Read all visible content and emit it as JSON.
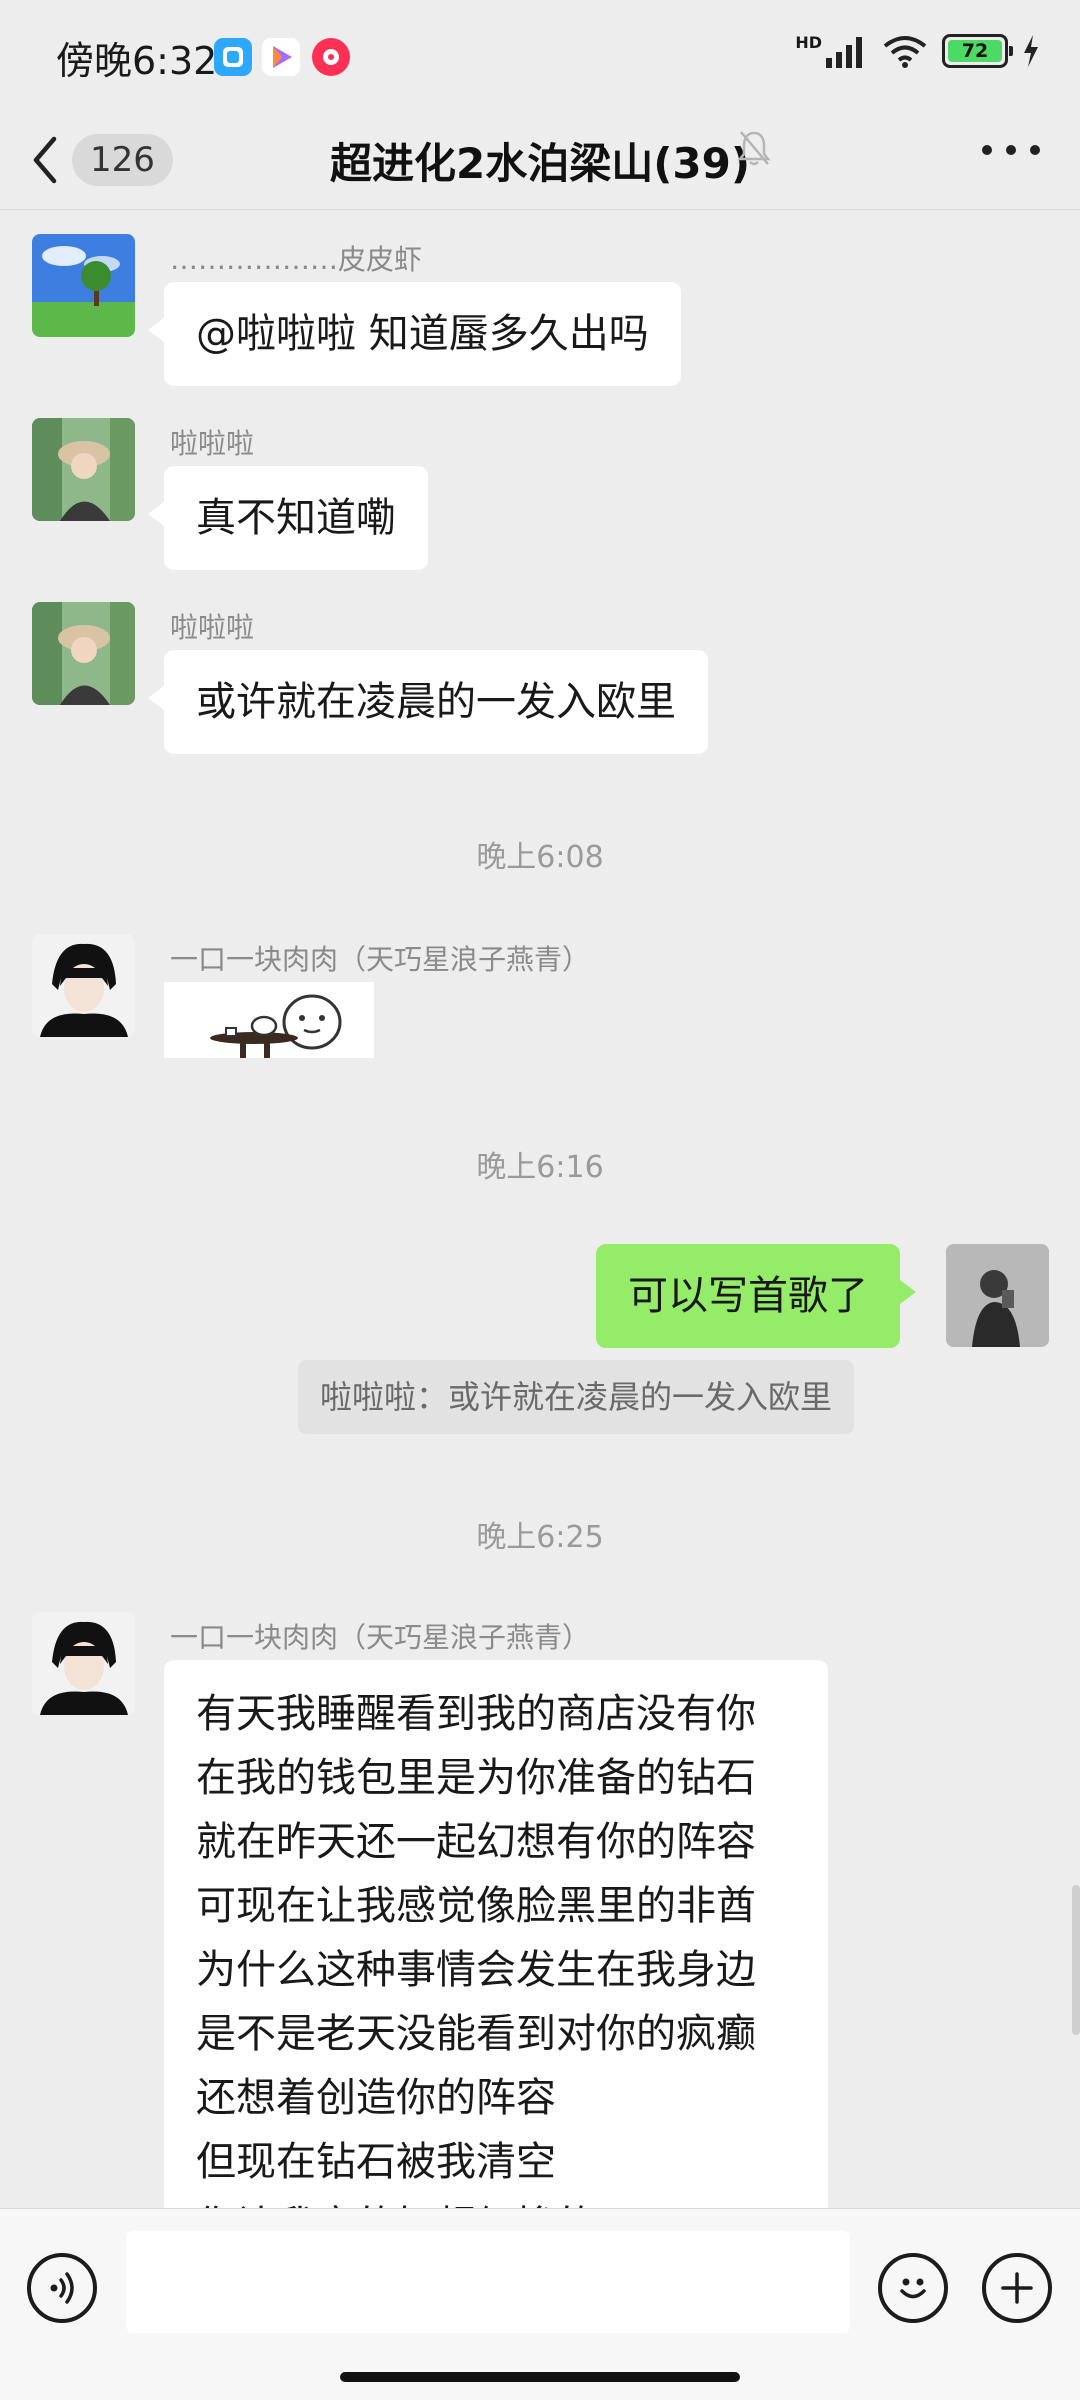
{
  "status_bar": {
    "time": "傍晚6:32",
    "network": "HD",
    "battery": "72"
  },
  "header": {
    "unread_count": "126",
    "title": "超进化2水泊梁山(39)"
  },
  "messages": [
    {
      "sender": "………………皮皮虾",
      "text": "@啦啦啦  知道蜃多久出吗"
    },
    {
      "sender": "啦啦啦",
      "text": "真不知道嘞"
    },
    {
      "sender": "啦啦啦",
      "text": "或许就在凌晨的一发入欧里"
    },
    {
      "sender": "一口一块肉肉（天巧星浪子燕青）"
    },
    {
      "text": "可以写首歌了"
    },
    {
      "sender": "一口一块肉肉（天巧星浪子燕青）"
    }
  ],
  "timestamps": [
    "晚上6:08",
    "晚上6:16",
    "晚上6:25"
  ],
  "quote": "啦啦啦：或许就在凌晨的一发入欧里",
  "long_message_lines": [
    "有天我睡醒看到我的商店没有你",
    "在我的钱包里是为你准备的钻石",
    "就在昨天还一起幻想有你的阵容",
    "可现在让我感觉像脸黑里的非酋",
    "为什么这种事情会发生在我身边",
    "是不是老天没能看到对你的疯癫",
    "还想着创造你的阵容",
    "但现在钻石被我清空",
    "你让我变的好超级惨的"
  ],
  "colors": {
    "background": "#ededed",
    "my_bubble": "#95ec69",
    "other_bubble": "#ffffff",
    "input_bar": "#f7f7f7"
  }
}
